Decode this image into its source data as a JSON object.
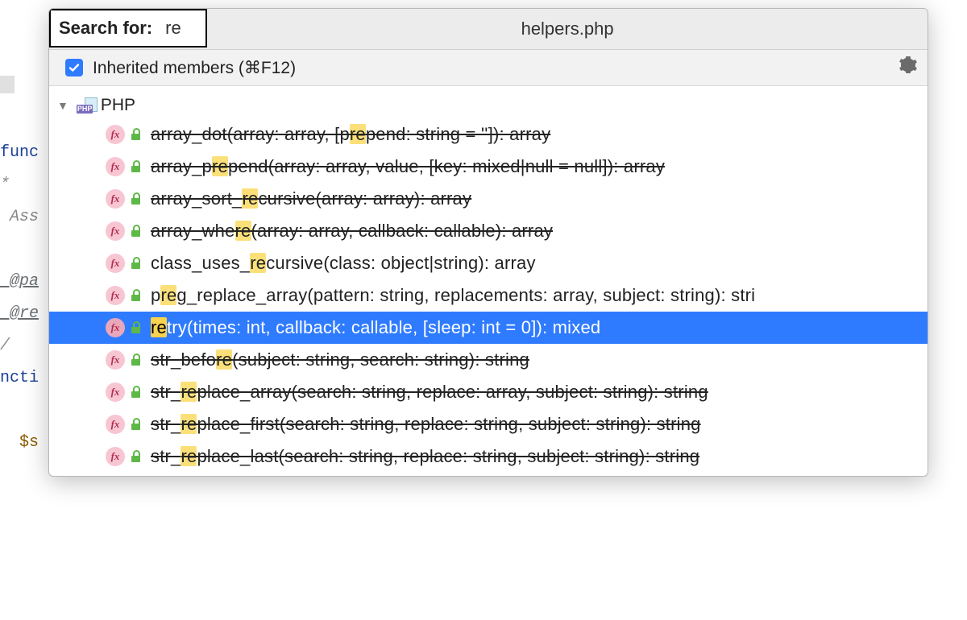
{
  "title": "helpers.php",
  "search": {
    "label": "Search for:",
    "query": "re"
  },
  "options": {
    "inherited_label": "Inherited members (⌘F12)",
    "inherited_checked": true
  },
  "group_label": "PHP",
  "editor_snippets": {
    "func": "func",
    "star": "*",
    "ass": " Ass",
    "pa": " @pa",
    "re": " @re",
    "slash": "/",
    "ncti": "ncti",
    "s": "  $s"
  },
  "items": [
    {
      "before": "array_dot(array: array, [p",
      "match": "re",
      "after": "pend: string = '']): array",
      "deprecated": true,
      "selected": false
    },
    {
      "before": "array_p",
      "match": "re",
      "after": "pend(array: array, value, [key: mixed|null = null]): array",
      "deprecated": true,
      "selected": false
    },
    {
      "before": "array_sort_",
      "match": "re",
      "after": "cursive(array: array): array",
      "deprecated": true,
      "selected": false
    },
    {
      "before": "array_whe",
      "match": "re",
      "after": "(array: array, callback: callable): array",
      "deprecated": true,
      "selected": false
    },
    {
      "before": "class_uses_",
      "match": "re",
      "after": "cursive(class: object|string): array",
      "deprecated": false,
      "selected": false
    },
    {
      "before": "p",
      "match": "re",
      "after": "g_replace_array(pattern: string, replacements: array, subject: string): stri",
      "deprecated": false,
      "selected": false
    },
    {
      "before": "",
      "match": "re",
      "after": "try(times: int, callback: callable, [sleep: int = 0]): mixed",
      "deprecated": false,
      "selected": true
    },
    {
      "before": "str_befo",
      "match": "re",
      "after": "(subject: string, search: string): string",
      "deprecated": true,
      "selected": false
    },
    {
      "before": "str_",
      "match": "re",
      "after": "place_array(search: string, replace: array, subject: string): string",
      "deprecated": true,
      "selected": false
    },
    {
      "before": "str_",
      "match": "re",
      "after": "place_first(search: string, replace: string, subject: string): string",
      "deprecated": true,
      "selected": false
    },
    {
      "before": "str_",
      "match": "re",
      "after": "place_last(search: string, replace: string, subject: string): string",
      "deprecated": true,
      "selected": false
    }
  ]
}
